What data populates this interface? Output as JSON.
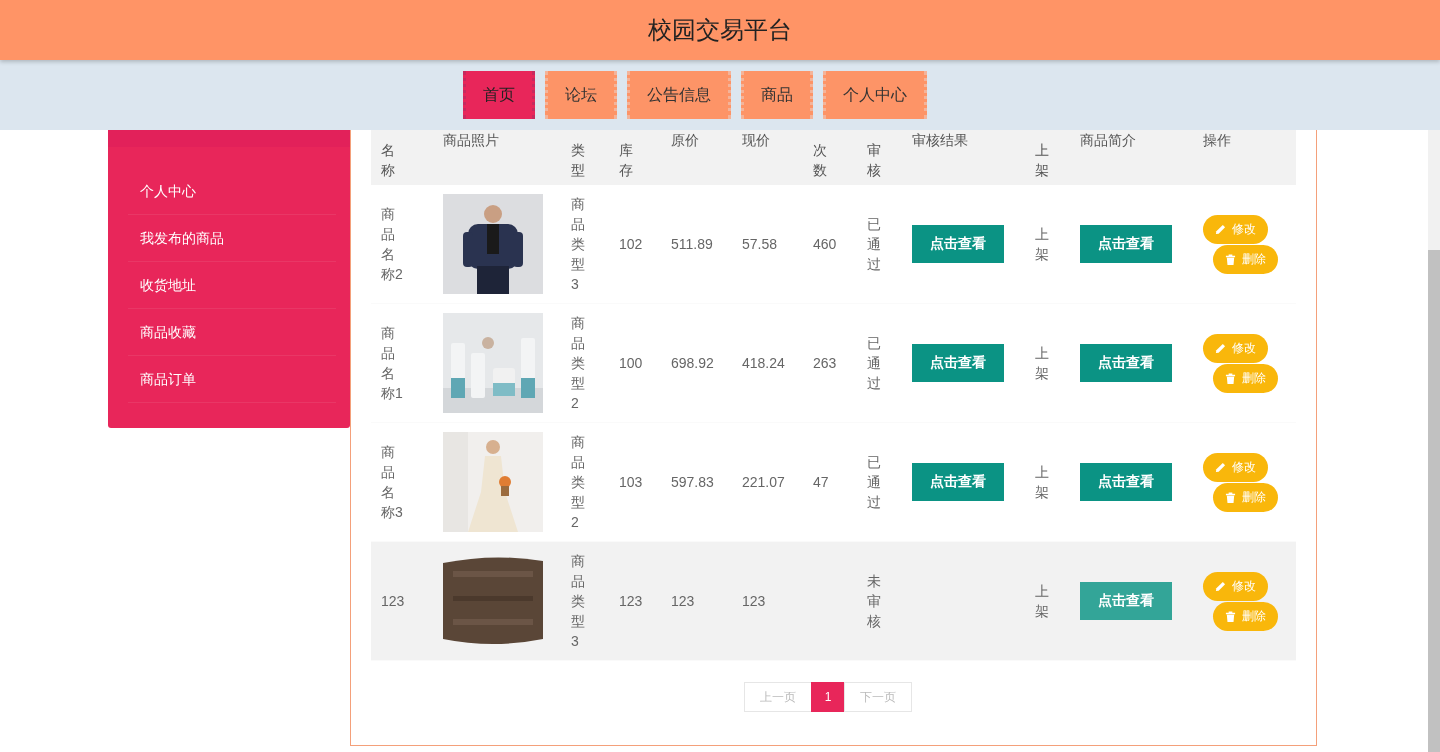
{
  "header": {
    "title": "校园交易平台"
  },
  "nav": [
    {
      "label": "首页",
      "selected": true
    },
    {
      "label": "论坛",
      "selected": false
    },
    {
      "label": "公告信息",
      "selected": false
    },
    {
      "label": "商品",
      "selected": false
    },
    {
      "label": "个人中心",
      "selected": false
    }
  ],
  "sidebar": {
    "items": [
      {
        "label": "个人中心"
      },
      {
        "label": "我发布的商品"
      },
      {
        "label": "收货地址"
      },
      {
        "label": "商品收藏"
      },
      {
        "label": "商品订单"
      }
    ]
  },
  "table": {
    "columns": [
      "名称",
      "商品照片",
      "类型",
      "库存",
      "原价",
      "现价",
      "次数",
      "审核",
      "审核结果",
      "上架",
      "商品简介",
      "操作"
    ],
    "rows": [
      {
        "name": "商品名称2",
        "type": "商品类型3",
        "stock": "102",
        "price": "511.89",
        "current": "57.58",
        "count": "460",
        "audit": "已通过",
        "result_button": "点击查看",
        "shelf": "上架",
        "intro_button": "点击查看",
        "edit": "修改",
        "delete": "删除",
        "hovered": false
      },
      {
        "name": "商品名称1",
        "type": "商品类型2",
        "stock": "100",
        "price": "698.92",
        "current": "418.24",
        "count": "263",
        "audit": "已通过",
        "result_button": "点击查看",
        "shelf": "上架",
        "intro_button": "点击查看",
        "edit": "修改",
        "delete": "删除",
        "hovered": false
      },
      {
        "name": "商品名称3",
        "type": "商品类型2",
        "stock": "103",
        "price": "597.83",
        "current": "221.07",
        "count": "47",
        "audit": "已通过",
        "result_button": "点击查看",
        "shelf": "上架",
        "intro_button": "点击查看",
        "edit": "修改",
        "delete": "删除",
        "hovered": false
      },
      {
        "name": "123",
        "type": "商品类型3",
        "stock": "123",
        "price": "123",
        "current": "123",
        "audit": "未审核",
        "shelf": "上架",
        "intro_button": "点击查看",
        "edit": "修改",
        "delete": "删除",
        "hovered": true
      }
    ]
  },
  "pagination": {
    "prev": "上一页",
    "pages": [
      {
        "label": "1",
        "selected": true
      }
    ],
    "next": "下一页"
  }
}
